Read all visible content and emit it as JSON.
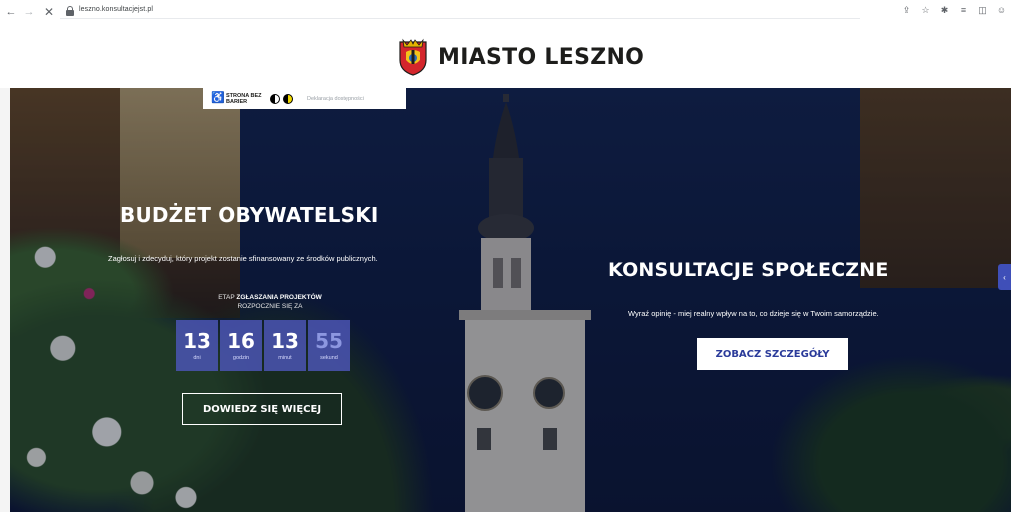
{
  "browser": {
    "url": "leszno.konsultacjejst.pl",
    "back_icon": "←",
    "forward_icon": "→",
    "stop_icon": "✕"
  },
  "header": {
    "logo_text": "MIASTO LESZNO"
  },
  "accessibility": {
    "label": "STRONA BEZ BARIER",
    "declaration": "Deklaracja dostępności"
  },
  "budzet": {
    "title": "BUDŻET OBYWATELSKI",
    "description": "Zagłosuj i zdecyduj, który projekt zostanie sfinansowany ze środków publicznych.",
    "etap_prefix": "ETAP",
    "etap_name": "ZGŁASZANIA PROJEKTÓW",
    "etap_sub": "ROZPOCZNIE SIĘ ZA",
    "countdown": [
      {
        "value": "13",
        "label": "dni"
      },
      {
        "value": "16",
        "label": "godzin"
      },
      {
        "value": "13",
        "label": "minut"
      },
      {
        "value": "55",
        "label": "sekund"
      }
    ],
    "button": "DOWIEDZ SIĘ WIĘCEJ"
  },
  "konsultacje": {
    "title": "KONSULTACJE SPOŁECZNE",
    "description": "Wyraź opinię - miej realny wpływ na to, co dzieje się w Twoim samorządzie.",
    "button": "ZOBACZ SZCZEGÓŁY"
  },
  "colors": {
    "countdown_bg": "#4b55b4",
    "button_text": "#2b3b9a",
    "side_tab": "#3f4fb8"
  }
}
